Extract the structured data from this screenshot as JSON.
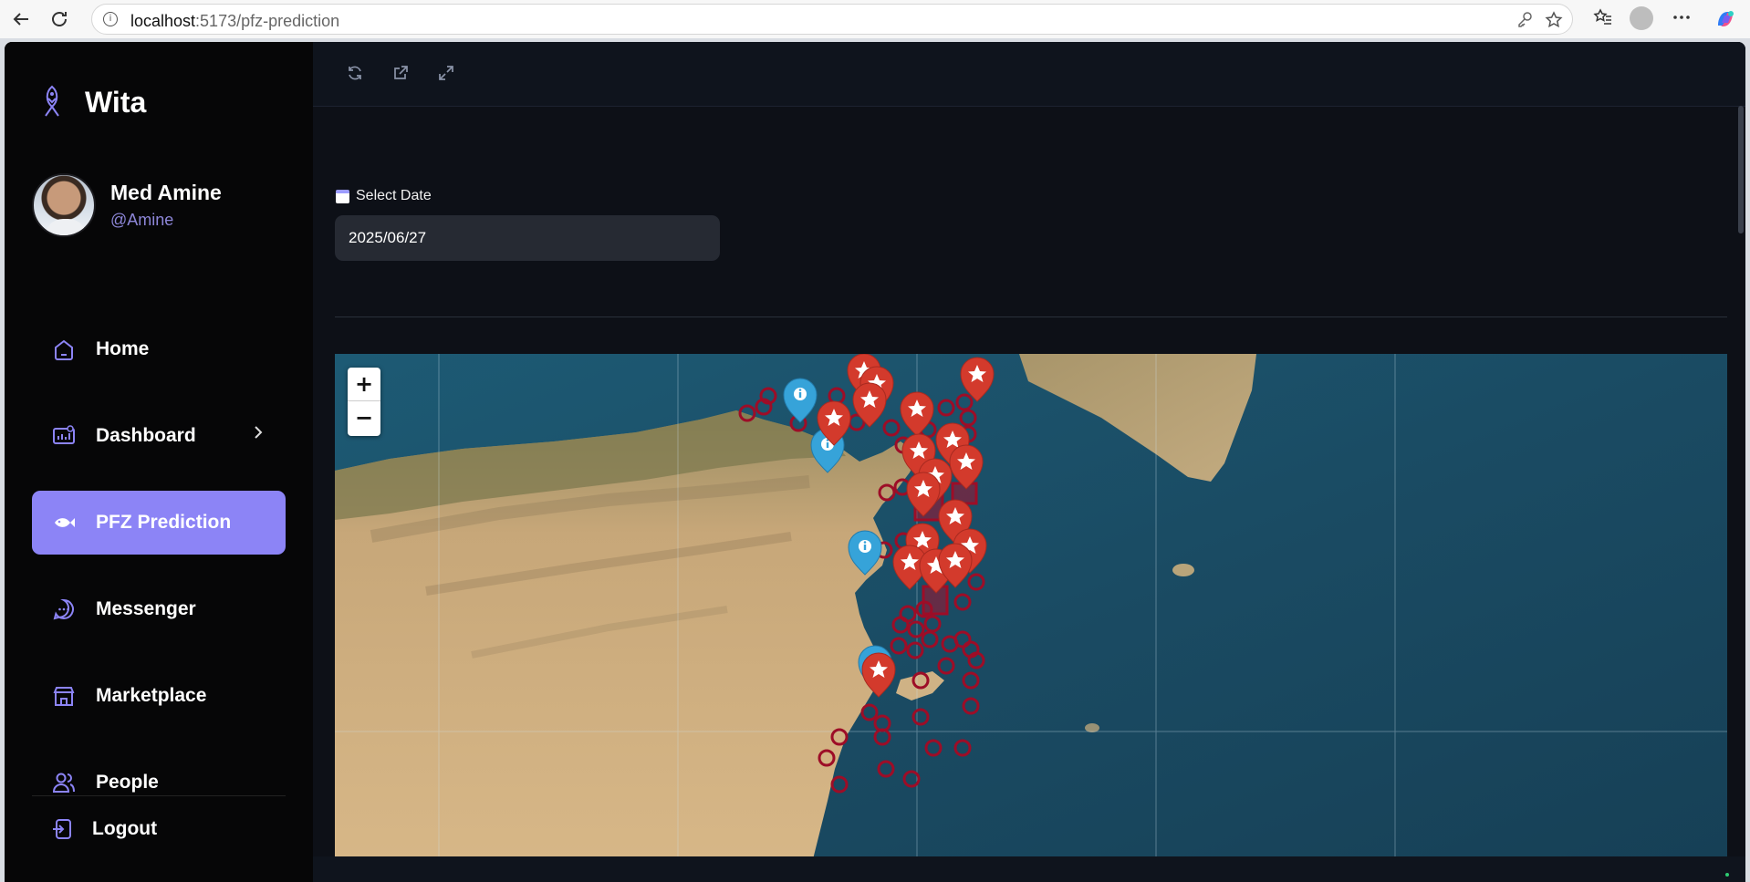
{
  "browser": {
    "url_host": "localhost",
    "url_rest": ":5173/pfz-prediction"
  },
  "app": {
    "brand": "Wita",
    "user": {
      "name": "Med Amine",
      "handle": "@Amine"
    },
    "menu": [
      {
        "label": "Home",
        "icon": "home-icon"
      },
      {
        "label": "Dashboard",
        "icon": "dashboard-icon",
        "has_submenu": true
      },
      {
        "label": "PFZ Prediction",
        "icon": "fish-icon",
        "active": true
      },
      {
        "label": "Messenger",
        "icon": "chat-icon"
      },
      {
        "label": "Marketplace",
        "icon": "store-icon"
      },
      {
        "label": "People",
        "icon": "people-icon"
      }
    ],
    "logout_label": "Logout",
    "accent_color": "#8c84f6"
  },
  "toolbar": {
    "icons": [
      "refresh-icon",
      "external-link-icon",
      "fullscreen-icon"
    ]
  },
  "date_picker": {
    "label": "Select Date",
    "value": "2025/06/27"
  },
  "map": {
    "zoom_in": "+",
    "zoom_out": "−",
    "pin_colors": {
      "star": "#d33a2c",
      "info": "#36a3d9",
      "zone": "#a4122e"
    }
  }
}
